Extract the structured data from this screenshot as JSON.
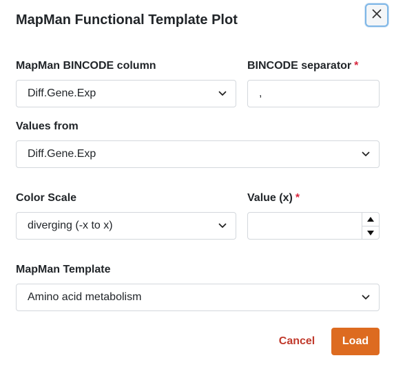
{
  "dialog": {
    "title": "MapMan Functional Template Plot",
    "close_icon": "close-icon"
  },
  "fields": {
    "bincode_column": {
      "label": "MapMan BINCODE column",
      "value": "Diff.Gene.Exp"
    },
    "bincode_separator": {
      "label": "BINCODE separator",
      "required_mark": "*",
      "value": ","
    },
    "values_from": {
      "label": "Values from",
      "value": "Diff.Gene.Exp"
    },
    "color_scale": {
      "label": "Color Scale",
      "value": "diverging (-x to x)"
    },
    "value_x": {
      "label": "Value (x)",
      "required_mark": "*",
      "value": ""
    },
    "template": {
      "label": "MapMan Template",
      "value": "Amino acid metabolism"
    }
  },
  "actions": {
    "cancel_label": "Cancel",
    "load_label": "Load"
  },
  "colors": {
    "accent": "#dd6b20",
    "cancel": "#c0392b",
    "required": "#d7263d",
    "focus_ring": "#7eb6e6"
  }
}
